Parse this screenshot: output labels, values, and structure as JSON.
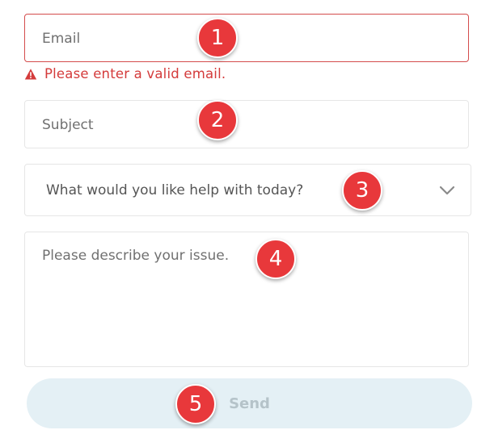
{
  "form": {
    "email": {
      "value": "",
      "placeholder": "Email"
    },
    "email_error": {
      "icon": "warning-icon",
      "text": "Please enter a valid email."
    },
    "subject": {
      "value": "",
      "placeholder": "Subject"
    },
    "help_select": {
      "selected": "What would you like help with today?",
      "icon": "chevron-down-icon"
    },
    "issue": {
      "value": "",
      "placeholder": "Please describe your issue."
    },
    "send_label": "Send"
  },
  "annotations": [
    "1",
    "2",
    "3",
    "4",
    "5"
  ],
  "colors": {
    "error": "#d43b3b",
    "error_border": "#d44c4c",
    "badge": "#e8383b",
    "send_bg": "#e4f0f5",
    "send_text": "#b5c3c9",
    "field_border": "#e6e6e6"
  }
}
